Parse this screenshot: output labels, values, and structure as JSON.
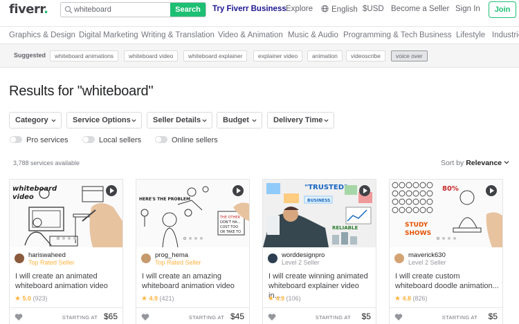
{
  "header": {
    "logo_text": "fiverr",
    "logo_dot": ".",
    "search_value": "whiteboard",
    "search_button": "Search",
    "nav": {
      "business": "Try Fiverr Business",
      "explore": "Explore",
      "language": "English",
      "currency": "$USD",
      "become_seller": "Become a Seller",
      "sign_in": "Sign In",
      "join": "Join"
    }
  },
  "categories": [
    "Graphics & Design",
    "Digital Marketing",
    "Writing & Translation",
    "Video & Animation",
    "Music & Audio",
    "Programming & Tech",
    "Business",
    "Lifestyle",
    "Industries"
  ],
  "suggested": {
    "label": "Suggested",
    "chips": [
      "whiteboard animations",
      "whiteboard video",
      "whiteboard explainer",
      "explainer video",
      "animation",
      "videoscribe",
      "voice over"
    ]
  },
  "results_title": "Results for \"whiteboard\"",
  "filters": [
    "Category",
    "Service Options",
    "Seller Details",
    "Budget",
    "Delivery Time"
  ],
  "toggles": [
    "Pro services",
    "Local sellers",
    "Online sellers"
  ],
  "services_count": "3,788 services available",
  "sort": {
    "label": "Sort by",
    "value": "Relevance"
  },
  "gigs": [
    {
      "seller": "hariswaheed",
      "level": "Top Rated Seller",
      "title": "I will create an animated whiteboard animation video",
      "score": "5.0",
      "reviews": "(923)",
      "starting_label": "STARTING AT",
      "price": "$65"
    },
    {
      "seller": "prog_hema",
      "level": "Top Rated Seller",
      "title": "I will create an amazing whiteboard animation video",
      "score": "4.9",
      "reviews": "(421)",
      "starting_label": "STARTING AT",
      "price": "$45"
    },
    {
      "seller": "worddesignpro",
      "level": "Level 2 Seller",
      "title": "I will create winning animated whiteboard explainer video in...",
      "score": "4.9",
      "reviews": "(106)",
      "starting_label": "STARTING AT",
      "price": "$5"
    },
    {
      "seller": "maverick630",
      "level": "Level 2 Seller",
      "title": "I will create custom whiteboard doodle animation...",
      "score": "4.8",
      "reviews": "(826)",
      "starting_label": "STARTING AT",
      "price": "$5"
    }
  ],
  "thumb_text": {
    "t1": "whiteboard video",
    "t2a": "HERE'S THE PROBLEM",
    "t2b": "THE OTHER DON'T HA... YOU CAN'T COST TOO... OR TAKE TO...",
    "t3a": "\"TRUSTED\"",
    "t3b": "RELIABLE",
    "t3c": "BUSINESS",
    "t4a": "80%",
    "t4b": "STUDY SHOWS"
  },
  "colors": {
    "brand": "#1dbf73",
    "business": "#1e1692",
    "star": "#ffb33e"
  }
}
